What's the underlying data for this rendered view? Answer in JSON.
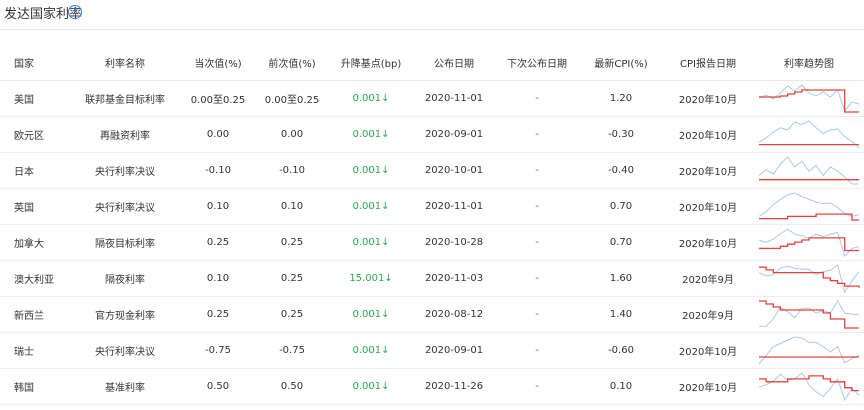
{
  "header": {
    "title": "发达国家利率",
    "help_icon": "question-circle-icon"
  },
  "colors": {
    "line_red": "#e8403b",
    "line_blue": "#a9c8ec",
    "up_green": "#2fa84a"
  },
  "table": {
    "columns": [
      "国家",
      "利率名称",
      "当次值(%)",
      "前次值(%)",
      "升降基点(bp)",
      "公布日期",
      "下次公布日期",
      "最新CPI(%)",
      "CPI报告日期",
      "利率趋势图"
    ],
    "rows": [
      {
        "country": "美国",
        "rate_name": "联邦基金目标利率",
        "current": "0.00至0.25",
        "previous": "0.00至0.25",
        "change": "0.001↓",
        "date": "2020-11-01",
        "next_date": "-",
        "cpi": "1.20",
        "cpi_date": "2020年10月",
        "trend": {
          "rate": [
            1.7,
            1.7,
            1.7,
            1.8,
            2.0,
            2.2,
            2.4,
            2.4,
            2.4,
            2.4,
            2.4,
            2.4,
            0.2,
            0.2,
            0.2
          ],
          "cpi": [
            1.6,
            1.9,
            1.5,
            2.1,
            2.8,
            2.3,
            2.9,
            2.1,
            1.8,
            2.2,
            1.7,
            2.4,
            0.3,
            1.2,
            1.0
          ]
        }
      },
      {
        "country": "欧元区",
        "rate_name": "再融资利率",
        "current": "0.00",
        "previous": "0.00",
        "change": "0.001↓",
        "date": "2020-09-01",
        "next_date": "-",
        "cpi": "-0.30",
        "cpi_date": "2020年10月",
        "trend": {
          "rate": [
            0,
            0,
            0,
            0,
            0,
            0,
            0,
            0,
            0,
            0,
            0,
            0,
            0,
            0,
            0
          ],
          "cpi": [
            0.2,
            0.6,
            1.1,
            1.5,
            1.3,
            2.0,
            1.8,
            2.1,
            1.5,
            1.0,
            1.3,
            1.4,
            0.7,
            0.3,
            -0.3
          ]
        }
      },
      {
        "country": "日本",
        "rate_name": "央行利率决议",
        "current": "-0.10",
        "previous": "-0.10",
        "change": "0.001↓",
        "date": "2020-10-01",
        "next_date": "-",
        "cpi": "-0.40",
        "cpi_date": "2020年10月",
        "trend": {
          "rate": [
            -0.1,
            -0.1,
            -0.1,
            -0.1,
            -0.1,
            -0.1,
            -0.1,
            -0.1,
            -0.1,
            -0.1,
            -0.1,
            -0.1,
            -0.1,
            -0.1,
            -0.1
          ],
          "cpi": [
            0.2,
            0.6,
            0.3,
            1.0,
            1.5,
            0.8,
            1.2,
            0.5,
            0.9,
            0.2,
            0.8,
            0.5,
            0.1,
            -0.4,
            -0.4
          ]
        }
      },
      {
        "country": "英国",
        "rate_name": "央行利率决议",
        "current": "0.10",
        "previous": "0.10",
        "change": "0.001↓",
        "date": "2020-11-01",
        "next_date": "-",
        "cpi": "0.70",
        "cpi_date": "2020年10月",
        "trend": {
          "rate": [
            0.25,
            0.25,
            0.25,
            0.25,
            0.5,
            0.5,
            0.5,
            0.5,
            0.75,
            0.75,
            0.75,
            0.75,
            0.75,
            0.1,
            0.1
          ],
          "cpi": [
            0.5,
            1.0,
            1.8,
            2.4,
            2.9,
            3.1,
            2.7,
            2.4,
            2.1,
            1.9,
            2.0,
            1.5,
            0.8,
            0.5,
            0.7
          ]
        }
      },
      {
        "country": "加拿大",
        "rate_name": "隔夜目标利率",
        "current": "0.25",
        "previous": "0.25",
        "change": "0.001↓",
        "date": "2020-10-28",
        "next_date": "-",
        "cpi": "0.70",
        "cpi_date": "2020年10月",
        "trend": {
          "rate": [
            0.5,
            0.5,
            0.5,
            0.75,
            1.0,
            1.25,
            1.5,
            1.75,
            1.75,
            1.75,
            1.75,
            1.75,
            0.25,
            0.25,
            0.25
          ],
          "cpi": [
            1.5,
            1.2,
            1.6,
            2.2,
            2.8,
            2.2,
            2.0,
            1.7,
            2.2,
            1.9,
            2.2,
            2.4,
            -0.4,
            0.5,
            0.7
          ]
        }
      },
      {
        "country": "澳大利亚",
        "rate_name": "隔夜利率",
        "current": "0.10",
        "previous": "0.25",
        "change": "15.001↓",
        "date": "2020-11-03",
        "next_date": "-",
        "cpi": "1.60",
        "cpi_date": "2020年9月",
        "trend": {
          "rate": [
            2.0,
            1.75,
            1.5,
            1.5,
            1.5,
            1.5,
            1.5,
            1.5,
            1.5,
            1.0,
            0.75,
            0.5,
            0.25,
            0.25,
            0.1
          ],
          "cpi": [
            1.5,
            1.2,
            1.3,
            1.9,
            2.1,
            1.9,
            1.8,
            1.8,
            1.3,
            1.6,
            1.7,
            2.2,
            -0.3,
            0.7,
            1.6
          ]
        }
      },
      {
        "country": "新西兰",
        "rate_name": "官方现金利率",
        "current": "0.25",
        "previous": "0.25",
        "change": "0.001↓",
        "date": "2020-08-12",
        "next_date": "-",
        "cpi": "1.40",
        "cpi_date": "2020年9月",
        "trend": {
          "rate": [
            2.5,
            2.25,
            2.0,
            1.75,
            1.75,
            1.75,
            1.75,
            1.75,
            1.75,
            1.5,
            1.0,
            1.0,
            0.25,
            0.25,
            0.25
          ],
          "cpi": [
            0.4,
            0.4,
            1.0,
            2.0,
            1.6,
            1.1,
            1.9,
            1.9,
            1.5,
            1.7,
            1.5,
            2.5,
            1.5,
            1.4,
            1.4
          ]
        }
      },
      {
        "country": "瑞士",
        "rate_name": "央行利率决议",
        "current": "-0.75",
        "previous": "-0.75",
        "change": "0.001↓",
        "date": "2020-09-01",
        "next_date": "-",
        "cpi": "-0.60",
        "cpi_date": "2020年10月",
        "trend": {
          "rate": [
            -0.75,
            -0.75,
            -0.75,
            -0.75,
            -0.75,
            -0.75,
            -0.75,
            -0.75,
            -0.75,
            -0.75,
            -0.75,
            -0.75,
            -0.75,
            -0.75,
            -0.75
          ],
          "cpi": [
            -1.4,
            -0.6,
            0.2,
            0.5,
            0.8,
            1.1,
            1.0,
            0.6,
            0.6,
            0.2,
            -0.3,
            0.2,
            -1.3,
            -0.9,
            -0.6
          ]
        }
      },
      {
        "country": "韩国",
        "rate_name": "基准利率",
        "current": "0.50",
        "previous": "0.50",
        "change": "0.001↓",
        "date": "2020-11-26",
        "next_date": "-",
        "cpi": "0.10",
        "cpi_date": "2020年10月",
        "trend": {
          "rate": [
            1.5,
            1.25,
            1.25,
            1.25,
            1.5,
            1.5,
            1.5,
            1.75,
            1.75,
            1.5,
            1.25,
            1.25,
            0.75,
            0.5,
            0.5
          ],
          "cpi": [
            0.8,
            1.0,
            1.3,
            1.9,
            1.4,
            1.5,
            2.0,
            1.0,
            0.4,
            0.0,
            0.7,
            1.5,
            -0.3,
            0.7,
            0.1
          ]
        }
      }
    ]
  }
}
